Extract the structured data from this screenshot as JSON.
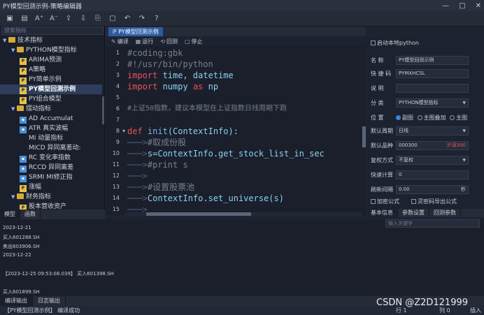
{
  "window": {
    "title": "PY模型回测示例-策略编辑器",
    "min": "—",
    "max": "□",
    "close": "✕"
  },
  "toolbar": {
    "icons": [
      "save-icon",
      "save-all-icon",
      "font-larger-icon",
      "font-smaller-icon",
      "export-icon",
      "import-icon",
      "copy-icon",
      "paste-icon",
      "undo-icon",
      "redo-icon",
      "help-icon"
    ]
  },
  "left": {
    "search_placeholder": "搜索指标",
    "tree": [
      {
        "label": "技术指标",
        "kind": "folder",
        "level": 0,
        "expanded": true
      },
      {
        "label": "PYTHON模型指标",
        "kind": "folder",
        "level": 1,
        "expanded": true
      },
      {
        "label": "ARIMA预测",
        "kind": "py",
        "level": 2
      },
      {
        "label": "A策略",
        "kind": "py",
        "level": 2
      },
      {
        "label": "PY简单示例",
        "kind": "py",
        "level": 2
      },
      {
        "label": "PY模型回测示例",
        "kind": "py",
        "level": 2,
        "selected": true
      },
      {
        "label": "PY组合模型",
        "kind": "py",
        "level": 2
      },
      {
        "label": "摆动指标",
        "kind": "folder",
        "level": 1,
        "expanded": true
      },
      {
        "label": "AD      Accumulat",
        "kind": "ind",
        "level": 2
      },
      {
        "label": "ATR     真实波幅",
        "kind": "ind",
        "level": 2
      },
      {
        "label": "MI      动量指标",
        "kind": "plain",
        "level": 2
      },
      {
        "label": "MICD    异同离差动:",
        "kind": "plain",
        "level": 2
      },
      {
        "label": "RC      变化率指数",
        "kind": "ind",
        "level": 2
      },
      {
        "label": "RCCD    异同离差",
        "kind": "ind",
        "level": 2
      },
      {
        "label": "SRMI    MI修正指",
        "kind": "ind",
        "level": 2
      },
      {
        "label": "涨幅",
        "kind": "py",
        "level": 2
      },
      {
        "label": "财务指标",
        "kind": "folder",
        "level": 1,
        "expanded": true
      },
      {
        "label": "股本营收资产",
        "kind": "py",
        "level": 2
      }
    ],
    "tabs": [
      "模型",
      "函数"
    ]
  },
  "editor": {
    "tab_label": "PY模型回测示例",
    "tools": [
      {
        "icon": "edit-icon",
        "label": "编译"
      },
      {
        "icon": "run-icon",
        "label": "运行"
      },
      {
        "icon": "reset-icon",
        "label": "回测"
      },
      {
        "icon": "stop-icon",
        "label": "停止"
      }
    ],
    "line_numbers": [
      "1",
      "2",
      "3",
      "4",
      "5",
      "6",
      "7",
      "8",
      "9",
      "10",
      "11",
      "12",
      "13",
      "14",
      "15"
    ],
    "fold_marker_line": 8
  },
  "code_text": {
    "l1": "#coding:gbk",
    "l2": "#!/usr/bin/python",
    "l3_kw": "import",
    "l3_rest": " time, datetime",
    "l4_kw": "import",
    "l4_a": " numpy ",
    "l4_as": "as",
    "l4_b": " np",
    "l6": "#上证50指数，建议本模型在上证指数日线周期下跑",
    "l8_kw": "def",
    "l8_fn": " init",
    "l8_rest": "(ContextInfo):",
    "l9_c": "#取成份股",
    "l10_a": "s=ContextInfo.get_stock_list_in_sec",
    "l11_c": "#print s",
    "l13_c": "#设置股票池",
    "l14_a": "ContextInfo.set_universe(s)",
    "guide": "───>"
  },
  "right": {
    "local_py_label": "启动本地python",
    "rows": [
      {
        "label": "名    称",
        "value": "PY模型回测示例",
        "type": "text"
      },
      {
        "label": "快 捷 码",
        "value": "PYMXHCSL",
        "type": "text"
      },
      {
        "label": "说    明",
        "value": "",
        "type": "text"
      },
      {
        "label": "分    类",
        "value": "PYTHON模型指标",
        "type": "select"
      }
    ],
    "position_label": "位    置",
    "position_options": [
      "副图",
      "主图叠加",
      "主图"
    ],
    "rows2": [
      {
        "label": "默认周期",
        "value": "日线",
        "type": "select"
      },
      {
        "label": "默认品种",
        "value": "000300",
        "suffix": "沪深300",
        "type": "text"
      },
      {
        "label": "复权方式",
        "value": "不复权",
        "type": "select"
      },
      {
        "label": "快速计算",
        "value": "0",
        "type": "text"
      },
      {
        "label": "刷新间隔",
        "value": "0.00",
        "suffix": "秒",
        "type": "text"
      }
    ],
    "encrypt_label": "加密公式",
    "export_label": "灵密码导出公式",
    "tabs": [
      "基本信息",
      "参数设置",
      "回测参数"
    ]
  },
  "output": {
    "search_placeholder": "输入关键字",
    "lines": [
      "2023-12-21",
      "买入601288.SH",
      "卖出603906.SH",
      "2023-12-22",
      "",
      "【2023-12-25 09:53:08.039】  买入601398.SH",
      "",
      "买入601899.SH"
    ],
    "tabs": [
      "编译输出",
      "日志输出"
    ]
  },
  "status": {
    "message": "【PY模型回测示例】 编译成功",
    "row": "行 1",
    "col": "列 0",
    "mode": "插入"
  },
  "watermark": "CSDN @Z2D121999",
  "colors": {
    "accent": "#2d5aa0",
    "keyword": "#e8535a",
    "function": "#7fb0f0",
    "comment": "#787f8f",
    "background": "#1a1f2b"
  }
}
